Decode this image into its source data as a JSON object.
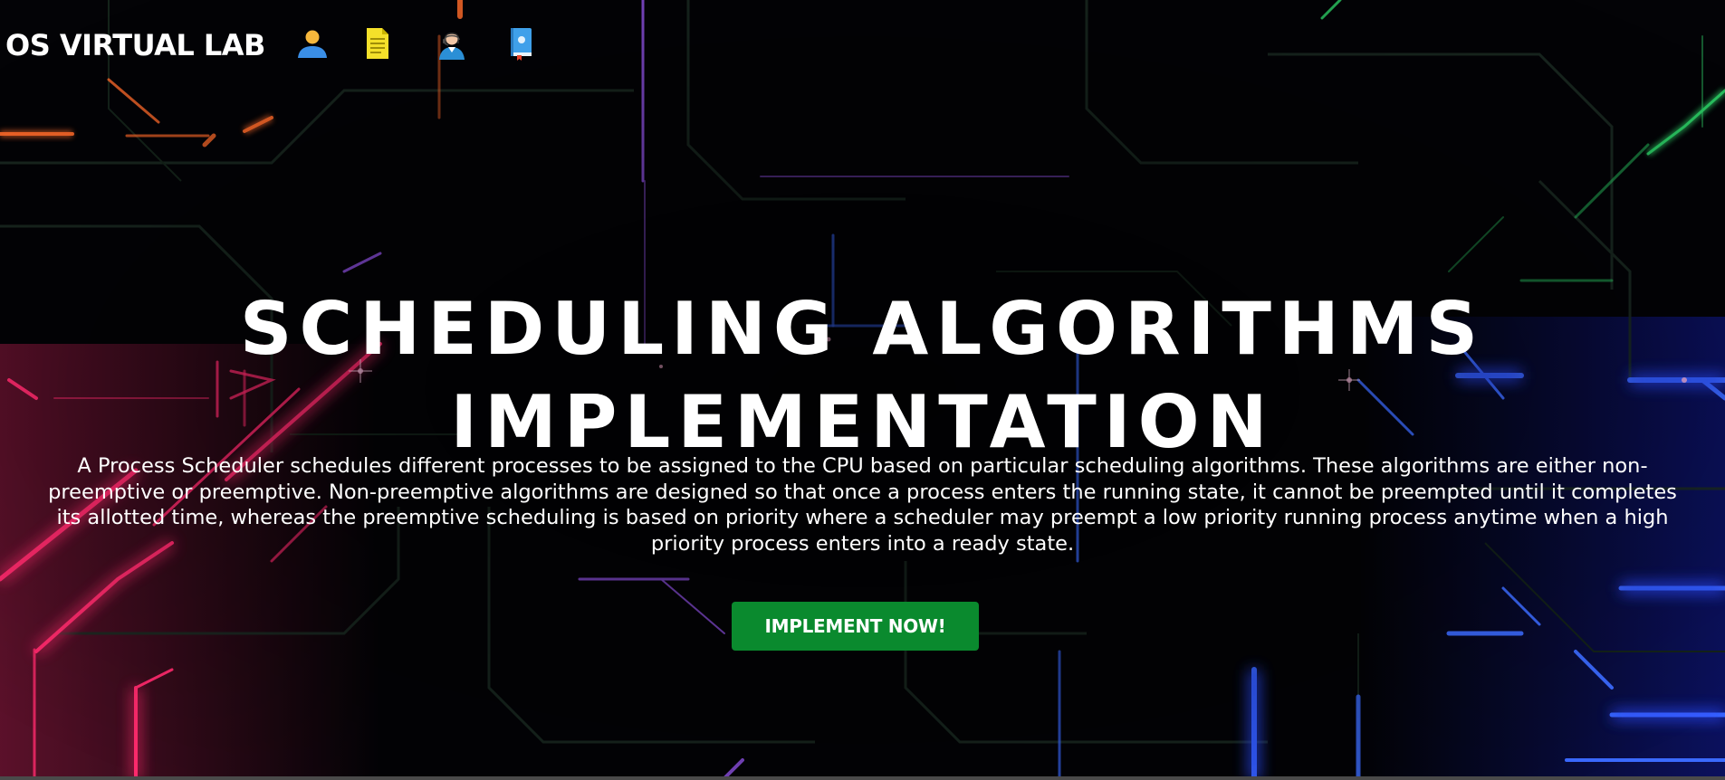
{
  "navbar": {
    "brand": "OS VIRTUAL LAB",
    "icons": [
      "user-icon",
      "document-icon",
      "support-agent-icon",
      "book-icon"
    ]
  },
  "hero": {
    "title_line1": "SCHEDULING ALGORITHMS",
    "title_line2": "IMPLEMENTATION",
    "description": "A Process Scheduler schedules different processes to be assigned to the CPU based on particular scheduling algorithms. These algorithms are either non-preemptive or preemptive. Non-preemptive algorithms are designed so that once a process enters the running state, it cannot be preempted until it completes its allotted time, whereas the preemptive scheduling is based on priority where a scheduler may preempt a low priority running process anytime when a high priority process enters into a ready state.",
    "cta_label": "IMPLEMENT NOW!"
  },
  "colors": {
    "cta_background": "#0a8a2e",
    "page_background": "#000000",
    "text": "#ffffff"
  }
}
